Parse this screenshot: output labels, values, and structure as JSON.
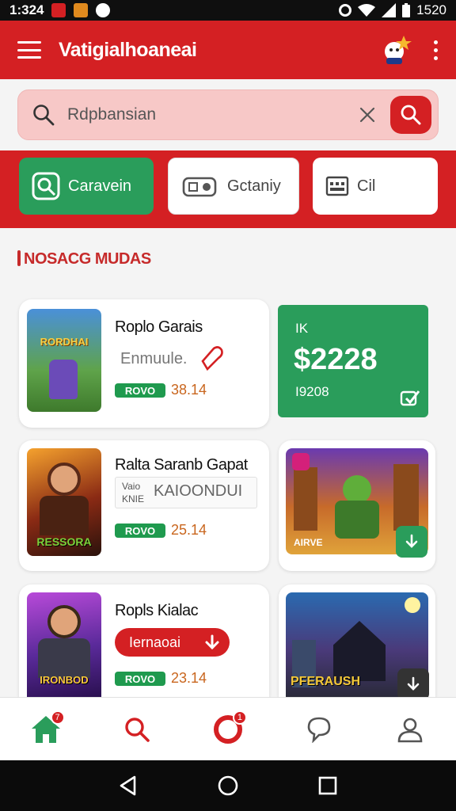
{
  "status_bar": {
    "time": "1:324",
    "battery": "1520"
  },
  "app_bar": {
    "title": "Vatigialhoaneai"
  },
  "search": {
    "placeholder": "Rdpbansian"
  },
  "filters": [
    {
      "label": "Caravein"
    },
    {
      "label": "Gctaniy"
    },
    {
      "label": "Cil"
    }
  ],
  "section": {
    "title": "NOSACG MUDAS"
  },
  "cards": [
    {
      "title": "Roplo Garais",
      "thumb_text": "RORDHAI",
      "subtitle": "Enmuule.",
      "tag": "ROVO",
      "rating": "38.14"
    },
    {
      "title": "Ralta Saranb Gapat",
      "thumb_text": "RESSORA",
      "subtitle_small_1": "Vaio",
      "subtitle_small_2": "KNIE",
      "subtitle": "KAIOONDUI",
      "tag": "ROVO",
      "rating": "25.14"
    },
    {
      "title": "Ropls Kialac",
      "thumb_text": "IRONBOD",
      "button_label": "Iernaoai",
      "tag": "ROVO",
      "rating": "23.14"
    }
  ],
  "promo": {
    "top": "IK",
    "price": "$2228",
    "bottom": "I9208"
  },
  "side_cards": [
    {
      "label": "AIRVE"
    },
    {
      "label": "PFERAUSH"
    }
  ],
  "bottom_nav": {
    "home_badge": "7",
    "notif_badge": "1"
  },
  "colors": {
    "brand": "#d42023",
    "accent": "#2a9d5b",
    "rating": "#c9661e"
  }
}
